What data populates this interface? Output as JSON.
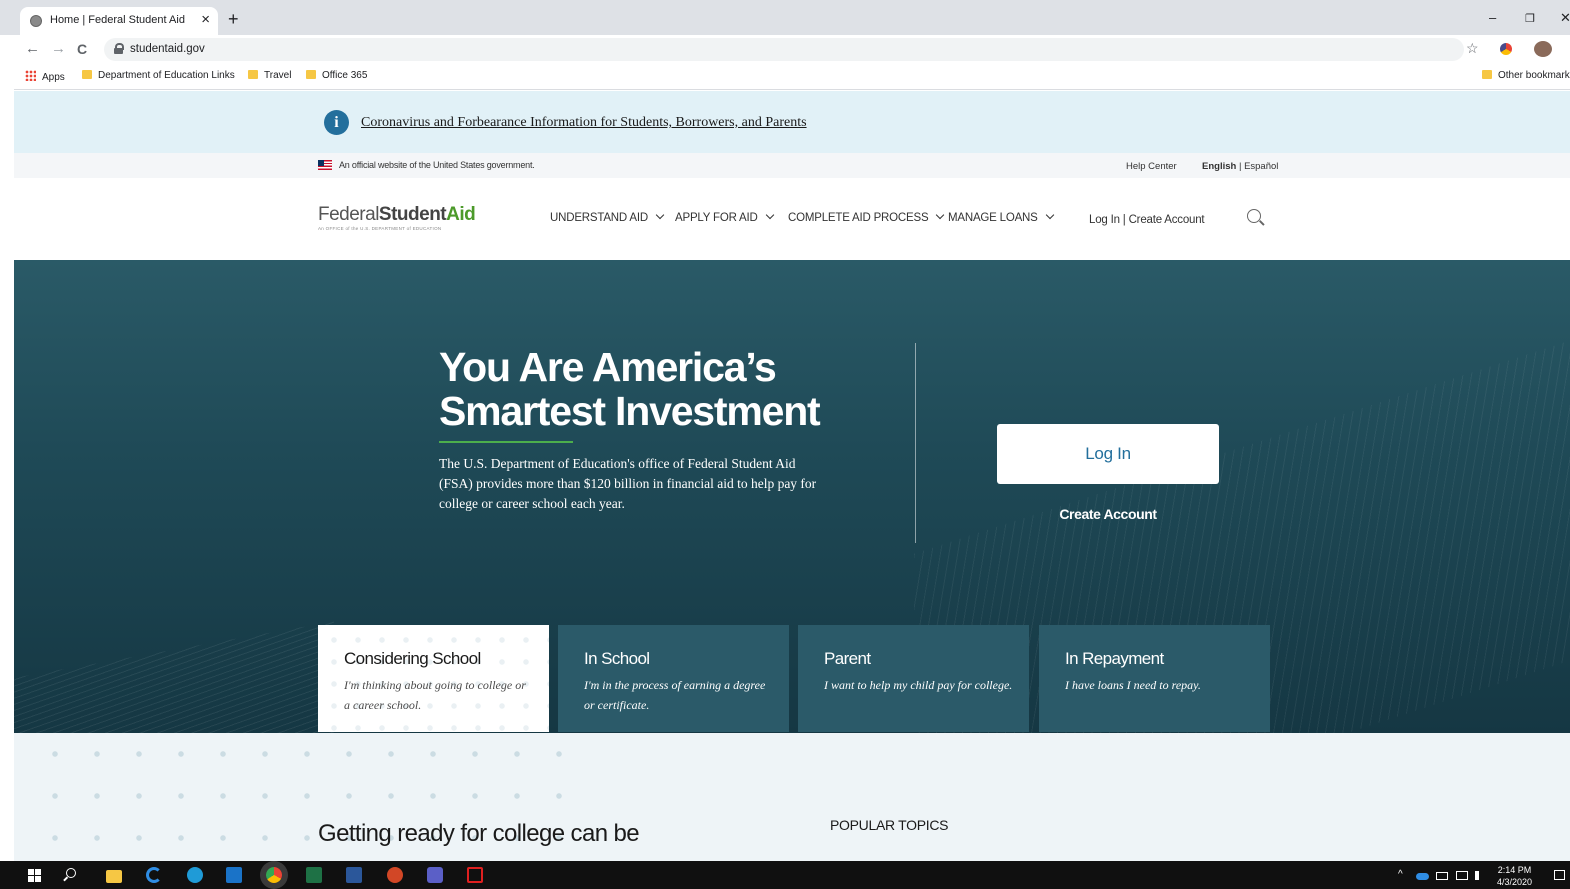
{
  "browser": {
    "tab_title": "Home | Federal Student Aid",
    "tab_close": "×",
    "new_tab": "+",
    "url": "studentaid.gov",
    "back": "←",
    "forward": "→",
    "reload": "C",
    "star": "☆",
    "minimize": "–",
    "restore": "❐",
    "close": "✕",
    "bookmarks": [
      {
        "label": "Apps"
      },
      {
        "label": "Department of Education Links"
      },
      {
        "label": "Travel"
      },
      {
        "label": "Office 365"
      }
    ],
    "other_bookmarks": "Other bookmarks"
  },
  "alert": {
    "icon": "i",
    "link": "Coronavirus and Forbearance Information for Students, Borrowers, and Parents"
  },
  "govbar": {
    "official": "An official website of the United States government.",
    "help": "Help Center",
    "lang_en": "English",
    "lang_sep": "|",
    "lang_es": "Español"
  },
  "nav": {
    "logo_federal": "Federal",
    "logo_student": "Student",
    "logo_aid": "Aid",
    "logo_sub": "An OFFICE of the U.S. DEPARTMENT of EDUCATION",
    "items": [
      {
        "label": "UNDERSTAND AID"
      },
      {
        "label": "APPLY FOR AID"
      },
      {
        "label": "COMPLETE AID PROCESS"
      },
      {
        "label": "MANAGE LOANS"
      }
    ],
    "login": "Log In",
    "sep": "|",
    "create": "Create Account"
  },
  "hero": {
    "title_line1": "You Are America’s",
    "title_line2": "Smartest Investment",
    "description": "The U.S. Department of Education's office of Federal Student Aid (FSA) provides more than $120 billion in financial aid to help pay for college or career school each year.",
    "login_button": "Log In",
    "create_account": "Create Account"
  },
  "cards": [
    {
      "title": "Considering School",
      "desc": "I'm thinking about going to college or a career school.",
      "active": true
    },
    {
      "title": "In School",
      "desc": "I'm in the process of earning a degree or certificate.",
      "active": false
    },
    {
      "title": "Parent",
      "desc": "I want to help my child pay for college.",
      "active": false
    },
    {
      "title": "In Repayment",
      "desc": "I have loans I need to repay.",
      "active": false
    }
  ],
  "lower": {
    "heading": "Getting ready for college can be",
    "popular": "POPULAR TOPICS"
  },
  "taskbar": {
    "time": "2:14 PM",
    "date": "4/3/2020",
    "tray": "^"
  },
  "colors": {
    "hero_bg": "#1f4a57",
    "accent_blue": "#236f9c",
    "logo_green": "#4c9a2a",
    "card_bg": "#2b5a69"
  }
}
